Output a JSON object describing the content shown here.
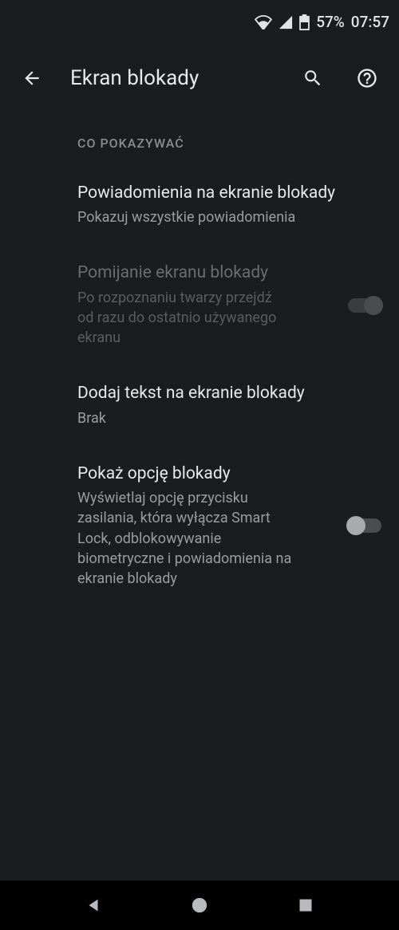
{
  "status_bar": {
    "battery_text": "57%",
    "time": "07:57"
  },
  "header": {
    "title": "Ekran blokady"
  },
  "section_header": "CO POKAZYWAĆ",
  "settings": {
    "notifications": {
      "title": "Powiadomienia na ekranie blokady",
      "subtitle": "Pokazuj wszystkie powiadomienia"
    },
    "skip_lockscreen": {
      "title": "Pomijanie ekranu blokady",
      "subtitle": "Po rozpoznaniu twarzy przejdź od razu do ostatnio używanego ekranu"
    },
    "add_text": {
      "title": "Dodaj tekst na ekranie blokady",
      "subtitle": "Brak"
    },
    "show_lockdown": {
      "title": "Pokaż opcję blokady",
      "subtitle": "Wyświetlaj opcję przycisku zasilania, która wyłącza Smart Lock, odblokowywanie biometryczne i powiadomienia na ekranie blokady"
    }
  }
}
